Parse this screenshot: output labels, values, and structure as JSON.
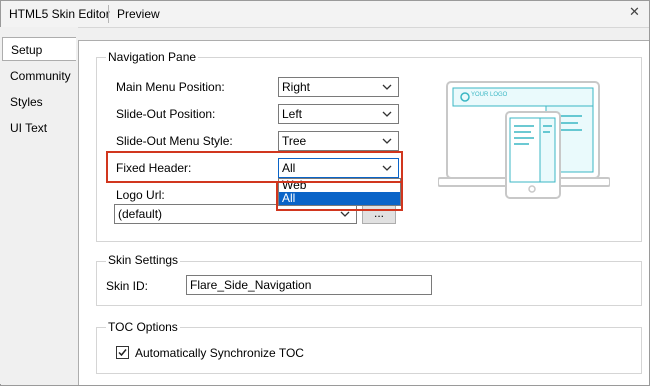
{
  "header": {
    "tabs": [
      "HTML5 Skin Editor",
      "Preview"
    ],
    "close_icon": "close-icon"
  },
  "sidebar": {
    "items": [
      "Setup",
      "Community",
      "Styles",
      "UI Text"
    ],
    "active": "Setup"
  },
  "navigation_pane": {
    "title": "Navigation Pane",
    "main_menu_position": {
      "label": "Main Menu Position:",
      "value": "Right"
    },
    "slide_out_position": {
      "label": "Slide-Out Position:",
      "value": "Left"
    },
    "slide_out_menu_style": {
      "label": "Slide-Out Menu Style:",
      "value": "Tree"
    },
    "fixed_header": {
      "label": "Fixed Header:",
      "value": "All",
      "options": [
        "Web",
        "All"
      ],
      "selected_option": "All"
    },
    "logo_url": {
      "label": "Logo Url:",
      "value": "(default)",
      "browse_label": "..."
    },
    "preview_logo_text": "YOUR LOGO"
  },
  "skin_settings": {
    "title": "Skin Settings",
    "skin_id_label": "Skin ID:",
    "skin_id_value": "Flare_Side_Navigation"
  },
  "toc_options": {
    "title": "TOC Options",
    "auto_sync_label": "Automatically Synchronize TOC",
    "auto_sync_checked": true
  },
  "colors": {
    "accent": "#3bb7c4",
    "highlight": "#d1361e",
    "selection": "#0a64c8"
  }
}
